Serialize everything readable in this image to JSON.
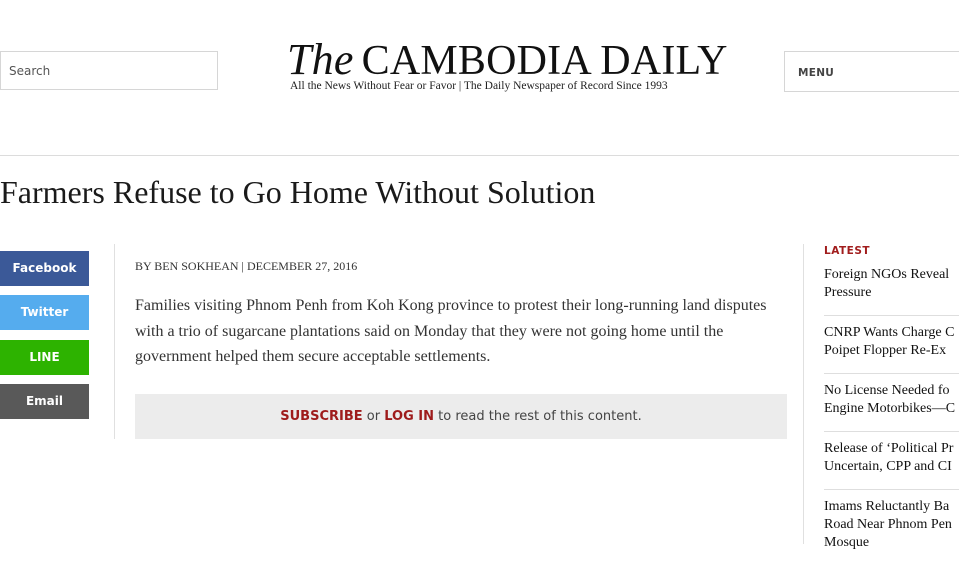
{
  "header": {
    "search_placeholder": "Search",
    "logo_the": "The",
    "logo_name": "CAMBODIA DAILY",
    "tagline": "All the News Without Fear or Favor | The Daily Newspaper of Record Since 1993",
    "menu_label": "MENU"
  },
  "article": {
    "headline": "Farmers Refuse to Go Home Without Solution",
    "byline": "BY BEN SOKHEAN | DECEMBER 27, 2016",
    "body": "Families visiting Phnom Penh from Koh Kong province to protest their long-running land disputes with a trio of sugarcane plantations said on Monday that they were not going home until the government helped them secure acceptable settlements."
  },
  "share": {
    "facebook": "Facebook",
    "twitter": "Twitter",
    "line": "LINE",
    "email": "Email"
  },
  "paywall": {
    "subscribe": "SUBSCRIBE",
    "or": "or",
    "login": "LOG IN",
    "rest": "to read the rest of this content."
  },
  "sidebar": {
    "latest_label": "LATEST",
    "items": [
      {
        "line1": "Foreign NGOs Reveal",
        "line2": "Pressure",
        "line3": ""
      },
      {
        "line1": "CNRP Wants Charge C",
        "line2": "Poipet Flopper Re-Ex",
        "line3": ""
      },
      {
        "line1": "No License Needed fo",
        "line2": "Engine Motorbikes—C",
        "line3": ""
      },
      {
        "line1": "Release of ‘Political Pr",
        "line2": "Uncertain, CPP and CI",
        "line3": ""
      },
      {
        "line1": "Imams Reluctantly Ba",
        "line2": "Road Near Phnom Pen",
        "line3": "Mosque"
      }
    ]
  },
  "colors": {
    "facebook": "#3b5998",
    "twitter": "#55acee",
    "line": "#2db300",
    "email": "#595959",
    "accent_red": "#a11d1d"
  }
}
